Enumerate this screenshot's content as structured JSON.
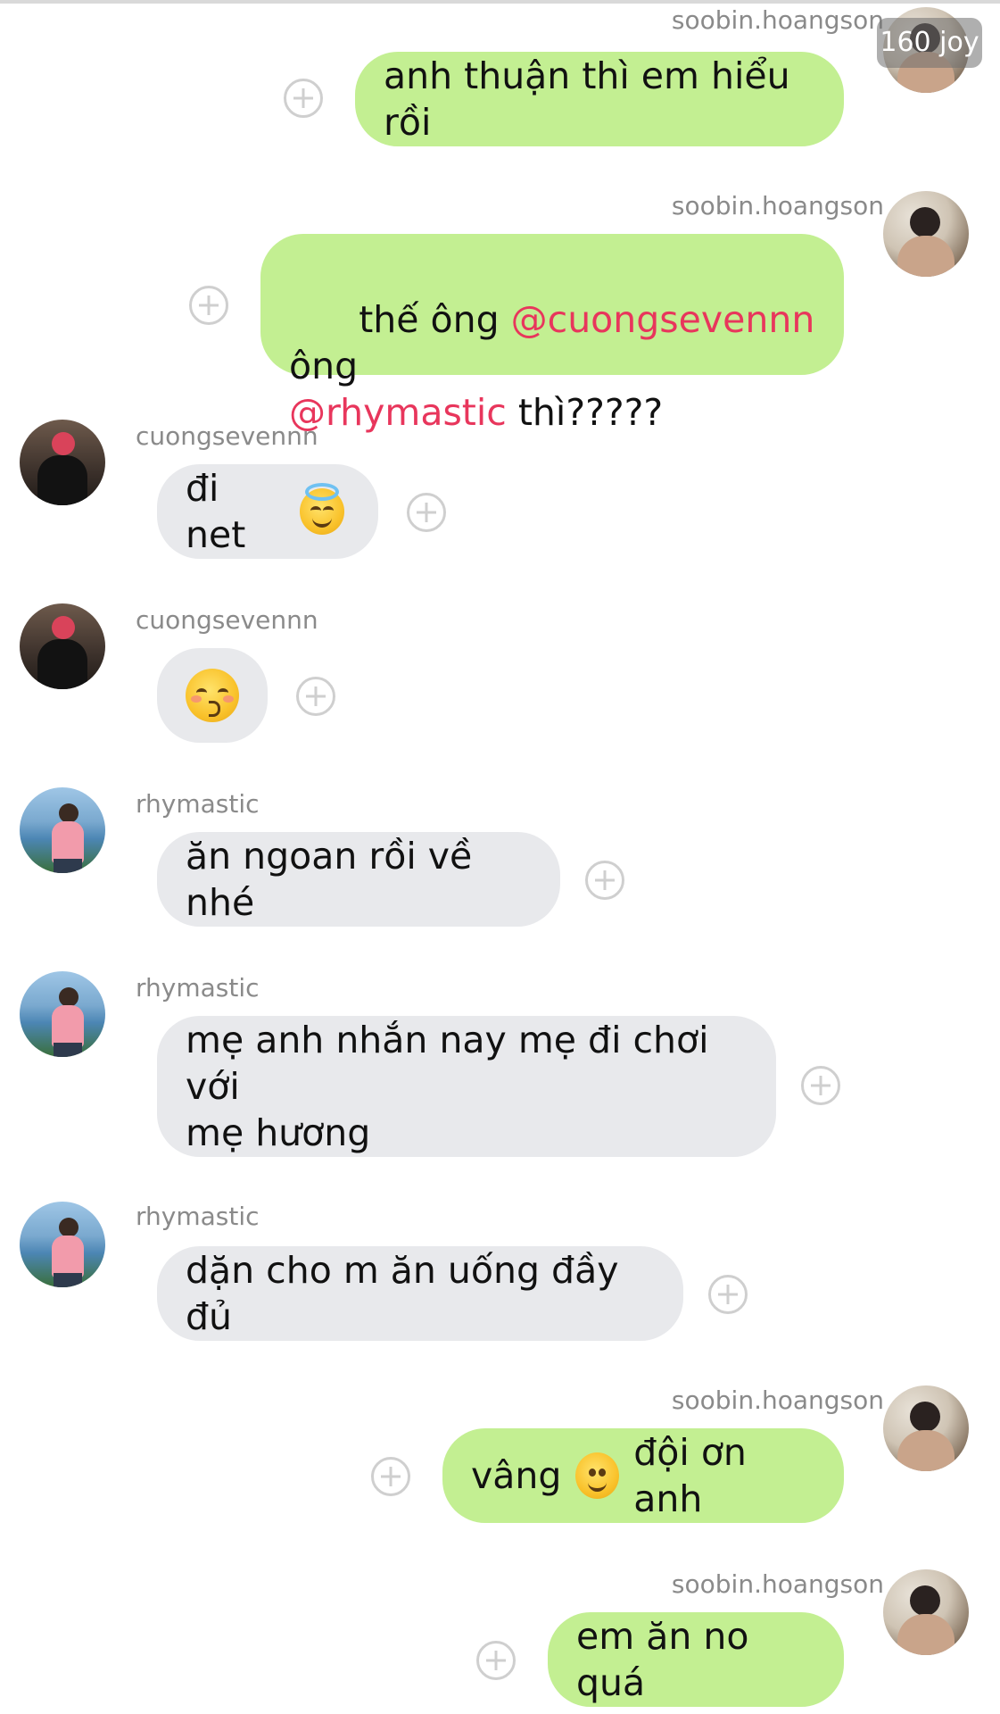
{
  "overlay": {
    "joy_badge": "160 joy"
  },
  "messages": [
    {
      "sender": "soobin.hoangson",
      "side": "right",
      "text": "anh thuận thì em hiểu rồi"
    },
    {
      "sender": "soobin.hoangson",
      "side": "right",
      "parts": [
        "thế ông ",
        "@cuongsevennn",
        " ông",
        "@rhymastic",
        " thì?????"
      ]
    },
    {
      "sender": "cuongsevennn",
      "side": "left",
      "text": "đi net",
      "emoji": "smiling-face-with-halo"
    },
    {
      "sender": "cuongsevennn",
      "side": "left",
      "emoji": "kissing-face-with-closed-eyes"
    },
    {
      "sender": "rhymastic",
      "side": "left",
      "text": "ăn ngoan rồi về nhé"
    },
    {
      "sender": "rhymastic",
      "side": "left",
      "text": "mẹ anh nhắn nay mẹ đi chơi với\nmẹ hương"
    },
    {
      "sender": "rhymastic",
      "side": "left",
      "text": "dặn cho m ăn uống đầy đủ"
    },
    {
      "sender": "soobin.hoangson",
      "side": "right",
      "text_before": "vâng",
      "emoji": "slightly-smiling-face",
      "text_after": "đội ơn anh"
    },
    {
      "sender": "soobin.hoangson",
      "side": "right",
      "text": "em ăn no quá"
    }
  ],
  "colors": {
    "outgoing_bubble": "#c3ef92",
    "incoming_bubble": "#e8e9ec",
    "mention": "#e8365c",
    "name": "#8a8a8a"
  }
}
